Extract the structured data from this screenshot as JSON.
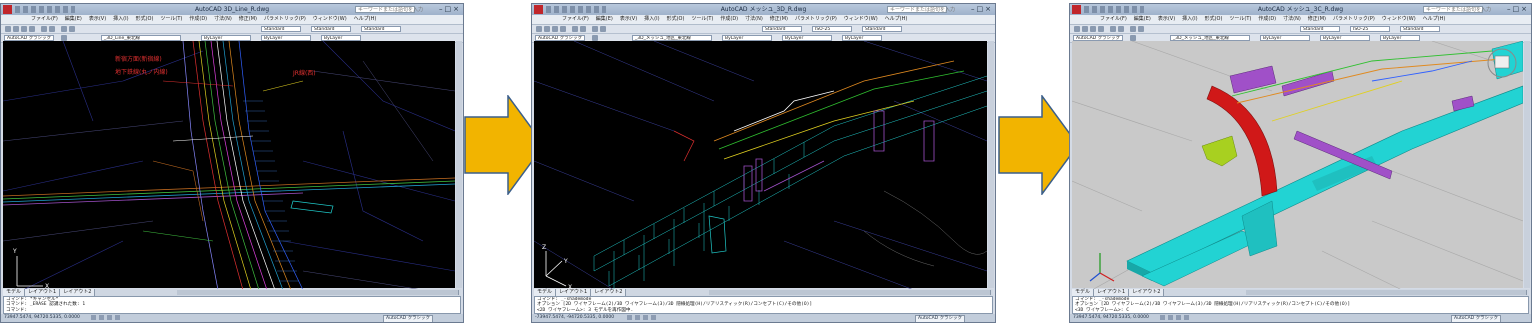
{
  "window1": {
    "title": "AutoCAD    3D_Line_R.dwg",
    "search_placeholder": "キーワードまたは語句を入力",
    "menus": [
      "ファイル(F)",
      "編集(E)",
      "表示(V)",
      "挿入(I)",
      "形式(O)",
      "ツール(T)",
      "作成(D)",
      "寸法(N)",
      "修正(M)",
      "パラメトリック(P)",
      "ウィンドウ(W)",
      "ヘルプ(H)"
    ],
    "workspace": "AutoCAD クラシック",
    "layer": "_3D_Line_東北線",
    "linetype": "ByLayer",
    "style1": "Standard",
    "style2": "Standard",
    "style3": "Standard",
    "annotations": [
      "新宿方面(新宿線)",
      "地下鉄線(丸ノ内線)",
      "JR線(西)"
    ],
    "tabs": [
      "モデル",
      "レイアウト1",
      "レイアウト2"
    ],
    "cmd_lines": [
      "コマンド: *キャンセル*",
      "コマンド: _ERASE  認識された数: 1",
      "コマンド: "
    ],
    "status_coords": "73947.5474, 94720.5335, 0.0000",
    "status_workspace": "AutoCAD クラシック"
  },
  "window2": {
    "title": "AutoCAD    メッシュ_3D_R.dwg",
    "search_placeholder": "キーワードまたは語句を入力",
    "menus": [
      "ファイル(F)",
      "編集(E)",
      "表示(V)",
      "挿入(I)",
      "形式(O)",
      "ツール(T)",
      "作成(D)",
      "寸法(N)",
      "修正(M)",
      "パラメトリック(P)",
      "ウィンドウ(W)",
      "ヘルプ(H)"
    ],
    "workspace": "AutoCAD クラシック",
    "layer": "_3D_メッシュ_地区_東北線",
    "linetype": "ByLayer",
    "style1": "Standard",
    "style2": "ISO-25",
    "style3": "Standard",
    "tabs": [
      "モデル",
      "レイアウト1",
      "レイアウト2"
    ],
    "cmd_lines": [
      "コマンド: _-shademode",
      "オプション [2D ワイヤフレーム(2)/3D ワイヤフレーム(3)/3D 隠線処理(H)/リアリスティック(R)/コンセプト(C)/その他(O)]",
      "<2D ワイヤフレーム>: 3 モデルを再作図中."
    ],
    "status_coords": "-73947.5474, -94720.5335, 0.0000",
    "status_workspace": "AutoCAD クラシック"
  },
  "window3": {
    "title": "AutoCAD    メッシュ_3C_R.dwg",
    "search_placeholder": "キーワードまたは語句を入力",
    "menus": [
      "ファイル(F)",
      "編集(E)",
      "表示(V)",
      "挿入(I)",
      "形式(O)",
      "ツール(T)",
      "作成(D)",
      "寸法(N)",
      "修正(M)",
      "パラメトリック(P)",
      "ウィンドウ(W)",
      "ヘルプ(H)"
    ],
    "workspace": "AutoCAD クラシック",
    "layer": "_3D_メッシュ_地区_東北線",
    "linetype": "ByLayer",
    "style1": "Standard",
    "style2": "ISO-25",
    "style3": "Standard",
    "tabs": [
      "モデル",
      "レイアウト1",
      "レイアウト2"
    ],
    "cmd_lines": [
      "コマンド: _-shademode",
      "オプション [2D ワイヤフレーム(2)/3D ワイヤフレーム(3)/3D 隠線処理(H)/リアリスティック(R)/コンセプト(C)/その他(O)]",
      "<3D ワイヤフレーム>: C"
    ],
    "status_coords": "73947.5474, 94720.5335, 0.0000",
    "status_workspace": "AutoCAD クラシック"
  },
  "colors": {
    "arrow": "#f2b400",
    "arrow_edge": "#3b5f8a",
    "canvas_dark": "#000000",
    "canvas_light": "#c9c9c9",
    "tunnel_cyan": "#22d3d3",
    "arc_red": "#d01818",
    "accent_purple": "#a050c8",
    "accent_lime": "#a8d020"
  }
}
